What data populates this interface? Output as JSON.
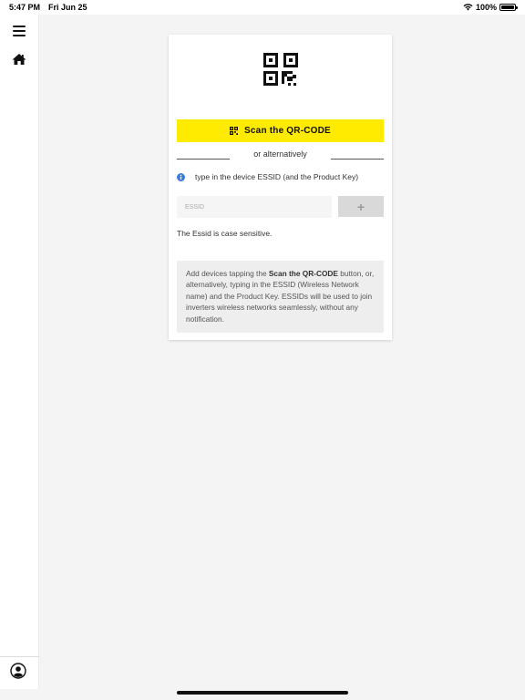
{
  "status_bar": {
    "time": "5:47 PM",
    "date": "Fri Jun 25",
    "battery": "100%"
  },
  "sidebar": {
    "items": [
      {
        "icon": "menu-icon"
      },
      {
        "icon": "home-icon"
      },
      {
        "icon": "profile-icon"
      }
    ]
  },
  "card": {
    "scan_button_label": "Scan the QR-CODE",
    "or_text": "or alternatively",
    "info_text": "type in the device ESSID (and the Product Key)",
    "essid_placeholder": "ESSID",
    "essid_value": "",
    "add_button_label": "+",
    "case_note": "The Essid is case sensitive.",
    "help": {
      "part1": "Add devices tapping the ",
      "bold": "Scan the QR-CODE",
      "part2": " button, or, alternatively, typing in the ESSID (Wireless Network name) and the Product Key. ESSIDs will be used to join inverters wireless networks seamlessly, without any notification."
    }
  },
  "colors": {
    "accent": "#ffeb00",
    "info": "#3b7ddd",
    "background": "#f4f4f4"
  }
}
